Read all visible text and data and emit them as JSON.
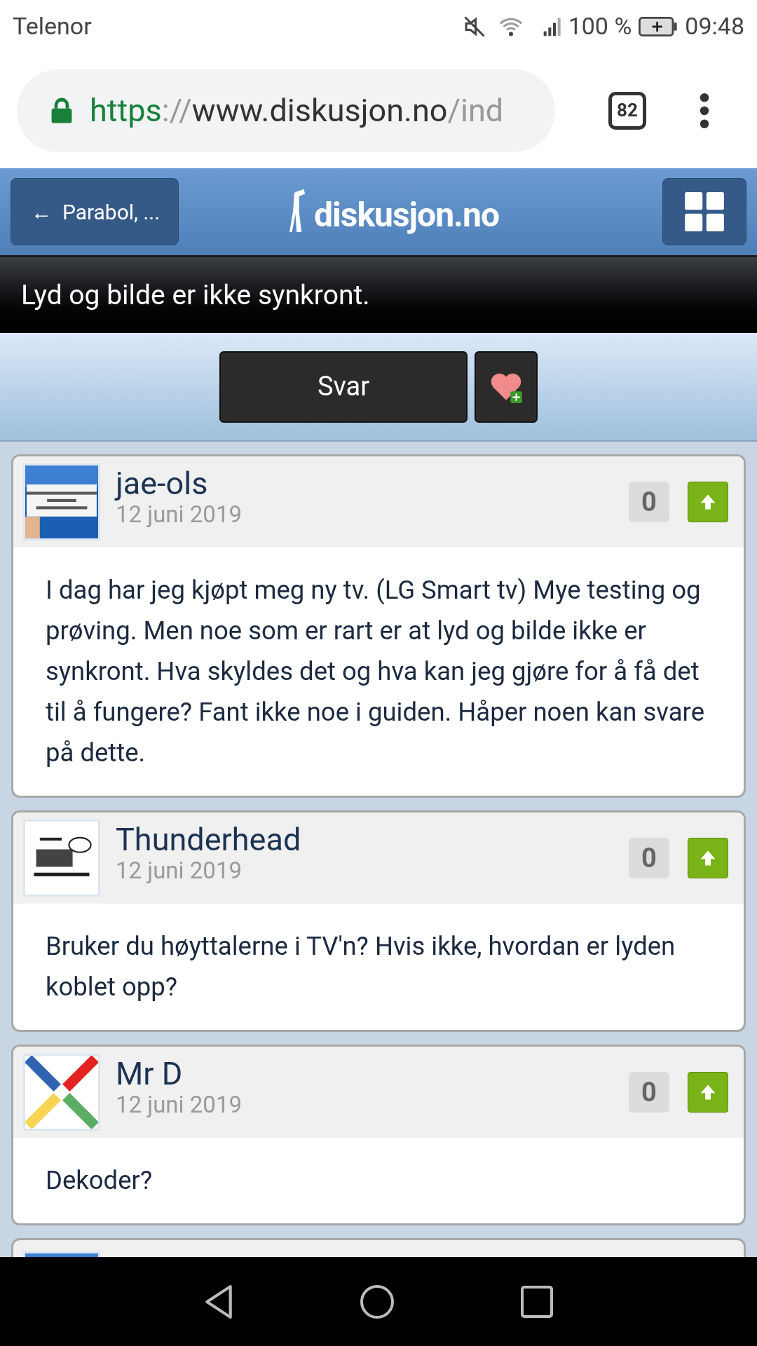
{
  "status_bar": {
    "carrier": "Telenor",
    "battery": "100 %",
    "time": "09:48"
  },
  "browser": {
    "url_scheme": "https",
    "url_sep": "://",
    "url_host": "www.diskusjon.no",
    "url_path": "/ind",
    "tab_count": "82"
  },
  "header": {
    "back_label": "←  Parabol, ...",
    "logo_text": "diskusjon.no"
  },
  "thread": {
    "title": "Lyd og bilde er ikke synkront.",
    "reply_button": "Svar"
  },
  "posts": [
    {
      "author": "jae-ols",
      "date": "12 juni 2019",
      "votes": "0",
      "text": "I dag har jeg kjøpt meg ny tv. (LG Smart tv) Mye testing og prøving. Men noe som er rart er at lyd og bilde ikke er synkront. Hva skyldes det og hva kan jeg gjøre for å få det til å fungere? Fant ikke noe i guiden. Håper noen kan svare på dette."
    },
    {
      "author": "Thunderhead",
      "date": "12 juni 2019",
      "votes": "0",
      "text": "Bruker du høyttalerne i TV'n? Hvis ikke, hvordan er lyden koblet opp?"
    },
    {
      "author": "Mr D",
      "date": "12 juni 2019",
      "votes": "0",
      "text": "Dekoder?"
    }
  ]
}
